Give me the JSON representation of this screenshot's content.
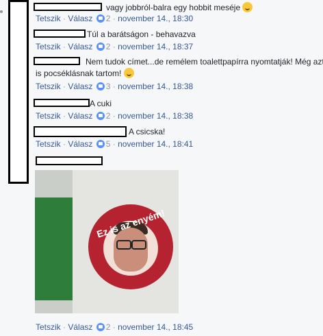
{
  "comments": [
    {
      "text": "vagy jobbról-balra egy hobbit meséje",
      "emoji": "grinning-emoji",
      "actions": {
        "like": "Tetszik",
        "reply": "Válasz",
        "likes": "2",
        "time": "november 14., 18:30"
      }
    },
    {
      "text": "Túl a barátságon - behavazva",
      "actions": {
        "like": "Tetszik",
        "reply": "Válasz",
        "likes": "2",
        "time": "november 14., 18:37"
      }
    },
    {
      "text_line1": "Nem tudok címet...de remélem toalettpapírra nyomtatják! Még azt",
      "text_line2": "is pocséklásnak tartom!",
      "emoji": "smiling-emoji",
      "actions": {
        "like": "Tetszik",
        "reply": "Válasz",
        "likes": "3",
        "time": "november 14., 18:38"
      }
    },
    {
      "text": "A cuki",
      "actions": {
        "like": "Tetszik",
        "reply": "Válasz",
        "likes": "2",
        "time": "november 14., 18:38"
      }
    },
    {
      "text": "A csicska!",
      "actions": {
        "like": "Tetszik",
        "reply": "Válasz",
        "likes": "5",
        "time": "november 14., 18:41"
      }
    },
    {
      "photo_text": "Ez is az enyém!",
      "actions": {
        "like": "Tetszik",
        "reply": "Válasz",
        "likes": "2",
        "time": "november 14., 18:45"
      }
    }
  ],
  "separator": "·",
  "colors": {
    "like_icon": "#5890ff",
    "link": "#365899",
    "meta": "#90949c",
    "redaction": "#000000"
  }
}
